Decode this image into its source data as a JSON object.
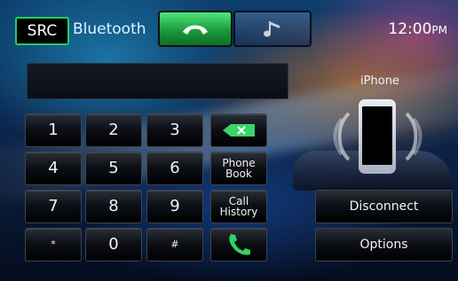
{
  "top_bar": {
    "src_label": "SRC",
    "app_title": "Bluetooth",
    "tabs": [
      {
        "name": "phone",
        "active": true,
        "icon": "handset-icon"
      },
      {
        "name": "music",
        "active": false,
        "icon": "music-note-icon"
      }
    ],
    "clock_time": "12:00",
    "clock_ampm": "PM"
  },
  "display": {
    "value": ""
  },
  "keypad": {
    "keys": [
      {
        "label": "1"
      },
      {
        "label": "2"
      },
      {
        "label": "3"
      },
      {
        "label": "4"
      },
      {
        "label": "5"
      },
      {
        "label": "6"
      },
      {
        "label": "7"
      },
      {
        "label": "8"
      },
      {
        "label": "9"
      },
      {
        "label": "*"
      },
      {
        "label": "0"
      },
      {
        "label": "#"
      }
    ],
    "backspace_icon": "backspace-x-icon",
    "phone_book": {
      "line1": "Phone",
      "line2": "Book"
    },
    "call_history": {
      "line1": "Call",
      "line2": "History"
    },
    "call_icon": "call-handset-icon"
  },
  "device": {
    "name": "iPhone"
  },
  "buttons": {
    "disconnect": "Disconnect",
    "options": "Options"
  },
  "colors": {
    "accent_green": "#22d05a",
    "background_blue": "#0b2c56"
  }
}
